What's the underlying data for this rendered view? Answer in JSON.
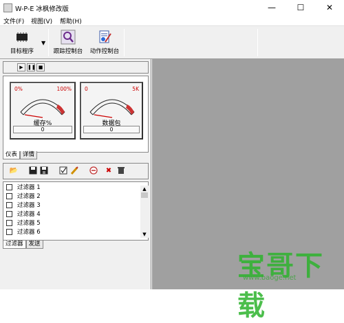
{
  "window": {
    "title": "W-P-E 冰枫修改版",
    "min": "—",
    "max": "☐",
    "close": "✕"
  },
  "menu": [
    "文件(F)",
    "视图(V)",
    "帮助(H)"
  ],
  "toolbar": {
    "target": "目标程序",
    "trace": "跟踪控制台",
    "action": "动作控制台"
  },
  "gauges": [
    {
      "min": "0%",
      "max": "100%",
      "label": "缓存%",
      "value": "0"
    },
    {
      "min": "0",
      "max": "5K",
      "label": "数据包",
      "value": "0"
    }
  ],
  "gauge_tabs": [
    "仪表",
    "详情"
  ],
  "filters": [
    "过滤器 1",
    "过滤器 2",
    "过滤器 3",
    "过滤器 4",
    "过滤器 5",
    "过滤器 6"
  ],
  "filter_tabs": [
    "过滤器",
    "发送"
  ],
  "watermark": {
    "text": "宝哥下载",
    "url": "www.baoge.net"
  }
}
